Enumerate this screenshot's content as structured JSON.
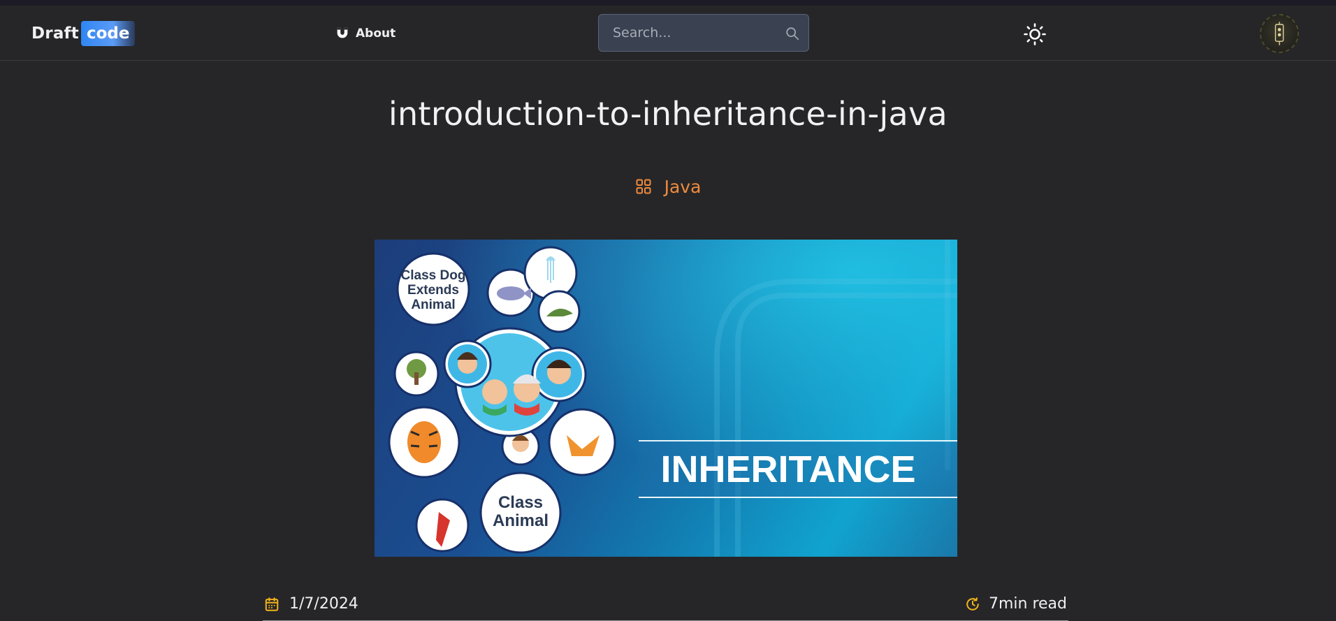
{
  "brand": {
    "part1": "Draft",
    "part2": "code"
  },
  "nav": {
    "about_label": "About"
  },
  "search": {
    "placeholder": "Search..."
  },
  "article": {
    "title": "introduction-to-inheritance-in-java",
    "category": "Java",
    "date": "1/7/2024",
    "read_time": "7min read",
    "hero_image": {
      "banner_text": "INHERITANCE",
      "bubble_1": [
        "Class Dog",
        "Extends",
        "Animal"
      ],
      "bubble_2": [
        "Class",
        "Animal"
      ]
    }
  },
  "colors": {
    "accent": "#f08a3c",
    "icon_yellow": "#f2b31b",
    "logo_blue": "#2f86f3"
  }
}
